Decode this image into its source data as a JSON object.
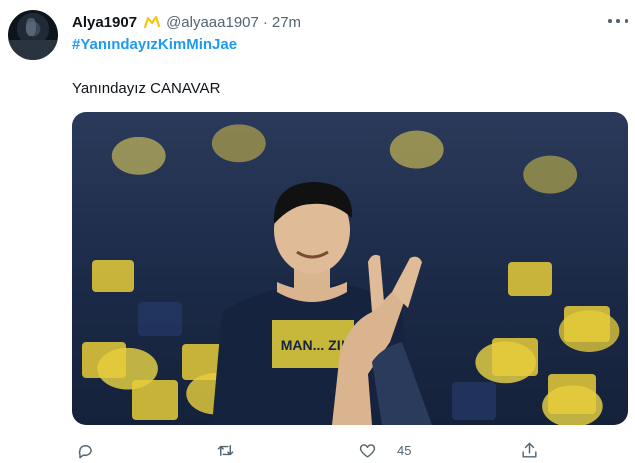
{
  "tweet": {
    "author": {
      "display_name": "Alya1907",
      "handle": "@alyaaa1907",
      "time": "27m",
      "badge_color": "#f5c518"
    },
    "hashtag": "#YanındayızKimMinJae",
    "text": "Yanındayız CANAVAR",
    "media": {
      "shirt_print": "MAN... ZI!"
    },
    "actions": {
      "reply_icon": "reply-icon",
      "retweet_icon": "retweet-icon",
      "like_icon": "like-icon",
      "like_count": "45",
      "share_icon": "share-icon"
    },
    "colors": {
      "link": "#1d9bf0",
      "secondary_text": "#536471",
      "primary_text": "#0f1419"
    }
  }
}
